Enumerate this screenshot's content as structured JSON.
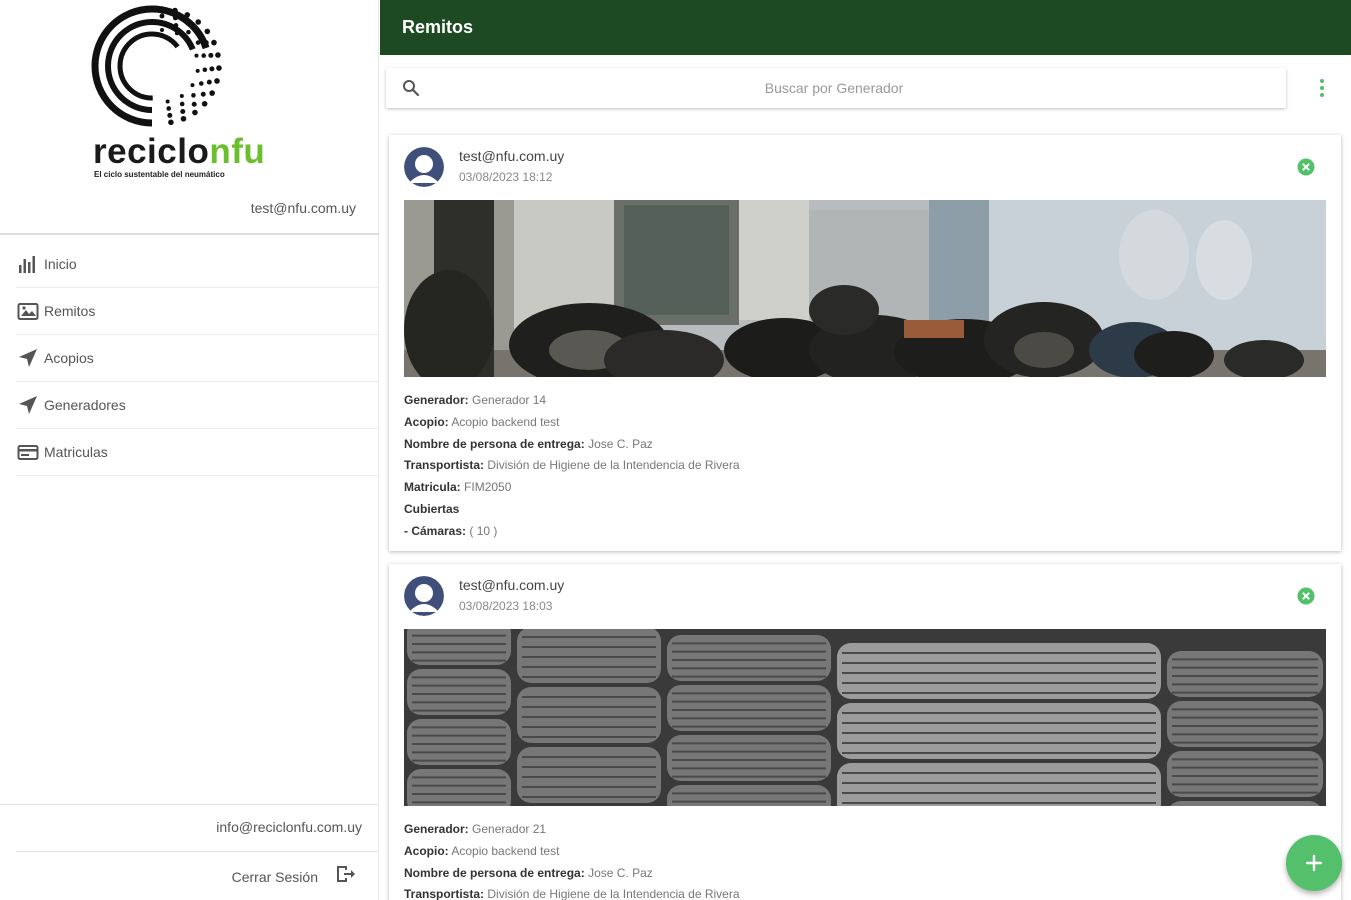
{
  "brand": {
    "name_part1": "reciclo",
    "name_part2": "nfu",
    "tagline": "El ciclo sustentable del neumático"
  },
  "sidebar": {
    "user_email": "test@nfu.com.uy",
    "items": [
      {
        "label": "Inicio",
        "icon": "bar-chart-icon"
      },
      {
        "label": "Remitos",
        "icon": "image-icon"
      },
      {
        "label": "Acopios",
        "icon": "navigation-arrow-icon"
      },
      {
        "label": "Generadores",
        "icon": "navigation-arrow-icon"
      },
      {
        "label": "Matriculas",
        "icon": "card-icon"
      }
    ],
    "contact_email": "info@reciclonfu.com.uy",
    "logout_label": "Cerrar Sesión"
  },
  "header": {
    "title": "Remitos"
  },
  "search": {
    "placeholder": "Buscar por Generador",
    "value": ""
  },
  "remitos": [
    {
      "user": "test@nfu.com.uy",
      "date": "03/08/2023 18:12",
      "labels": {
        "generador": "Generador:",
        "acopio": "Acopio:",
        "persona": "Nombre de persona de entrega:",
        "transportista": "Transportista:",
        "matricula": "Matricula:",
        "cubiertas": "Cubiertas",
        "camaras": "- Cámaras:"
      },
      "generador": "Generador 14",
      "acopio": "Acopio backend test",
      "persona": "Jose C. Paz",
      "transportista": "División de Higiene de la Intendencia de Rivera",
      "matricula": "FIM2050",
      "camaras": "( 10 )"
    },
    {
      "user": "test@nfu.com.uy",
      "date": "03/08/2023 18:03",
      "labels": {
        "generador": "Generador:",
        "acopio": "Acopio:",
        "persona": "Nombre de persona de entrega:",
        "transportista": "Transportista:"
      },
      "generador": "Generador 21",
      "acopio": "Acopio backend test",
      "persona": "Jose C. Paz",
      "transportista": "División de Higiene de la Intendencia de Rivera"
    }
  ],
  "colors": {
    "header": "#1d4a23",
    "accent_green": "#54c06c",
    "brand_green": "#6bbf2e"
  }
}
